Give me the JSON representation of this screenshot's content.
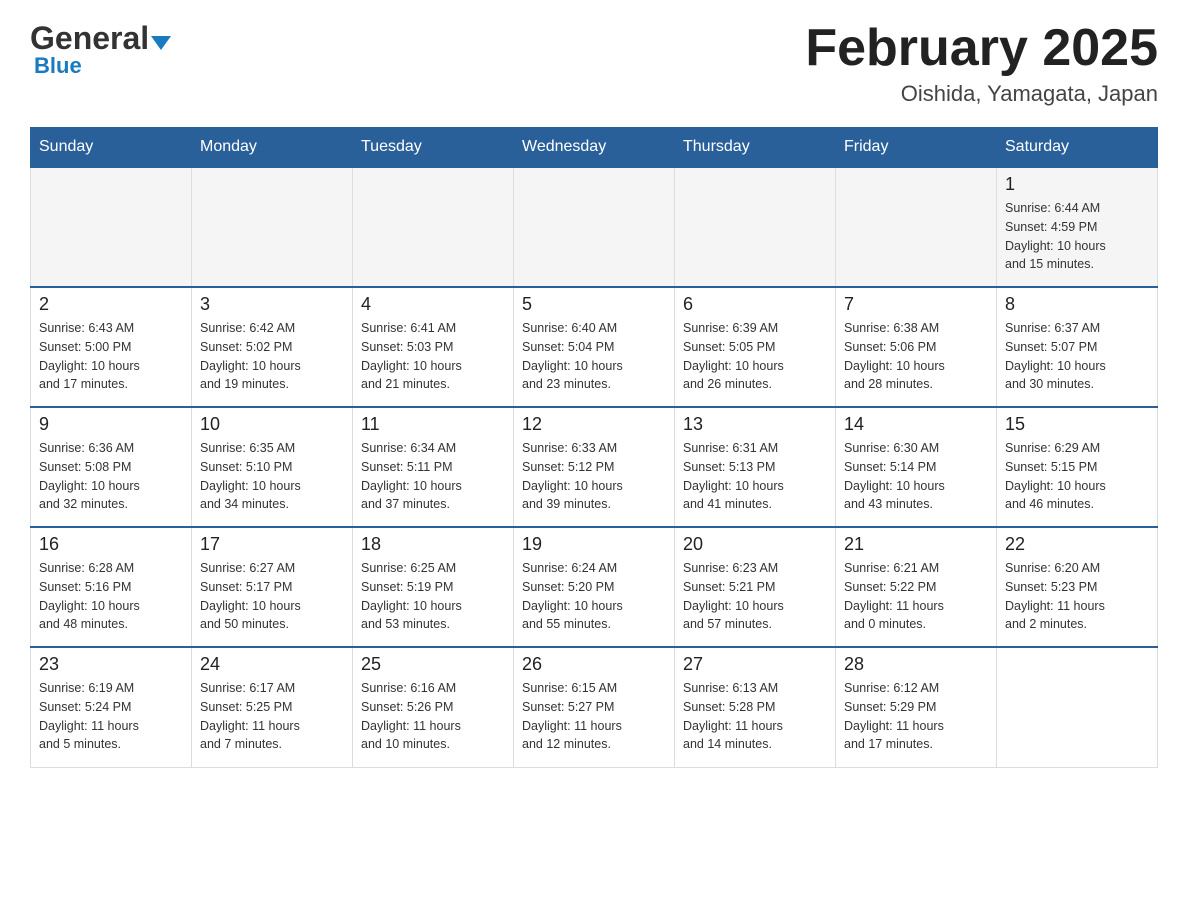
{
  "header": {
    "logo_general": "General",
    "logo_blue": "Blue",
    "month_title": "February 2025",
    "location": "Oishida, Yamagata, Japan"
  },
  "weekdays": [
    "Sunday",
    "Monday",
    "Tuesday",
    "Wednesday",
    "Thursday",
    "Friday",
    "Saturday"
  ],
  "weeks": [
    [
      {
        "day": "",
        "info": ""
      },
      {
        "day": "",
        "info": ""
      },
      {
        "day": "",
        "info": ""
      },
      {
        "day": "",
        "info": ""
      },
      {
        "day": "",
        "info": ""
      },
      {
        "day": "",
        "info": ""
      },
      {
        "day": "1",
        "info": "Sunrise: 6:44 AM\nSunset: 4:59 PM\nDaylight: 10 hours\nand 15 minutes."
      }
    ],
    [
      {
        "day": "2",
        "info": "Sunrise: 6:43 AM\nSunset: 5:00 PM\nDaylight: 10 hours\nand 17 minutes."
      },
      {
        "day": "3",
        "info": "Sunrise: 6:42 AM\nSunset: 5:02 PM\nDaylight: 10 hours\nand 19 minutes."
      },
      {
        "day": "4",
        "info": "Sunrise: 6:41 AM\nSunset: 5:03 PM\nDaylight: 10 hours\nand 21 minutes."
      },
      {
        "day": "5",
        "info": "Sunrise: 6:40 AM\nSunset: 5:04 PM\nDaylight: 10 hours\nand 23 minutes."
      },
      {
        "day": "6",
        "info": "Sunrise: 6:39 AM\nSunset: 5:05 PM\nDaylight: 10 hours\nand 26 minutes."
      },
      {
        "day": "7",
        "info": "Sunrise: 6:38 AM\nSunset: 5:06 PM\nDaylight: 10 hours\nand 28 minutes."
      },
      {
        "day": "8",
        "info": "Sunrise: 6:37 AM\nSunset: 5:07 PM\nDaylight: 10 hours\nand 30 minutes."
      }
    ],
    [
      {
        "day": "9",
        "info": "Sunrise: 6:36 AM\nSunset: 5:08 PM\nDaylight: 10 hours\nand 32 minutes."
      },
      {
        "day": "10",
        "info": "Sunrise: 6:35 AM\nSunset: 5:10 PM\nDaylight: 10 hours\nand 34 minutes."
      },
      {
        "day": "11",
        "info": "Sunrise: 6:34 AM\nSunset: 5:11 PM\nDaylight: 10 hours\nand 37 minutes."
      },
      {
        "day": "12",
        "info": "Sunrise: 6:33 AM\nSunset: 5:12 PM\nDaylight: 10 hours\nand 39 minutes."
      },
      {
        "day": "13",
        "info": "Sunrise: 6:31 AM\nSunset: 5:13 PM\nDaylight: 10 hours\nand 41 minutes."
      },
      {
        "day": "14",
        "info": "Sunrise: 6:30 AM\nSunset: 5:14 PM\nDaylight: 10 hours\nand 43 minutes."
      },
      {
        "day": "15",
        "info": "Sunrise: 6:29 AM\nSunset: 5:15 PM\nDaylight: 10 hours\nand 46 minutes."
      }
    ],
    [
      {
        "day": "16",
        "info": "Sunrise: 6:28 AM\nSunset: 5:16 PM\nDaylight: 10 hours\nand 48 minutes."
      },
      {
        "day": "17",
        "info": "Sunrise: 6:27 AM\nSunset: 5:17 PM\nDaylight: 10 hours\nand 50 minutes."
      },
      {
        "day": "18",
        "info": "Sunrise: 6:25 AM\nSunset: 5:19 PM\nDaylight: 10 hours\nand 53 minutes."
      },
      {
        "day": "19",
        "info": "Sunrise: 6:24 AM\nSunset: 5:20 PM\nDaylight: 10 hours\nand 55 minutes."
      },
      {
        "day": "20",
        "info": "Sunrise: 6:23 AM\nSunset: 5:21 PM\nDaylight: 10 hours\nand 57 minutes."
      },
      {
        "day": "21",
        "info": "Sunrise: 6:21 AM\nSunset: 5:22 PM\nDaylight: 11 hours\nand 0 minutes."
      },
      {
        "day": "22",
        "info": "Sunrise: 6:20 AM\nSunset: 5:23 PM\nDaylight: 11 hours\nand 2 minutes."
      }
    ],
    [
      {
        "day": "23",
        "info": "Sunrise: 6:19 AM\nSunset: 5:24 PM\nDaylight: 11 hours\nand 5 minutes."
      },
      {
        "day": "24",
        "info": "Sunrise: 6:17 AM\nSunset: 5:25 PM\nDaylight: 11 hours\nand 7 minutes."
      },
      {
        "day": "25",
        "info": "Sunrise: 6:16 AM\nSunset: 5:26 PM\nDaylight: 11 hours\nand 10 minutes."
      },
      {
        "day": "26",
        "info": "Sunrise: 6:15 AM\nSunset: 5:27 PM\nDaylight: 11 hours\nand 12 minutes."
      },
      {
        "day": "27",
        "info": "Sunrise: 6:13 AM\nSunset: 5:28 PM\nDaylight: 11 hours\nand 14 minutes."
      },
      {
        "day": "28",
        "info": "Sunrise: 6:12 AM\nSunset: 5:29 PM\nDaylight: 11 hours\nand 17 minutes."
      },
      {
        "day": "",
        "info": ""
      }
    ]
  ]
}
